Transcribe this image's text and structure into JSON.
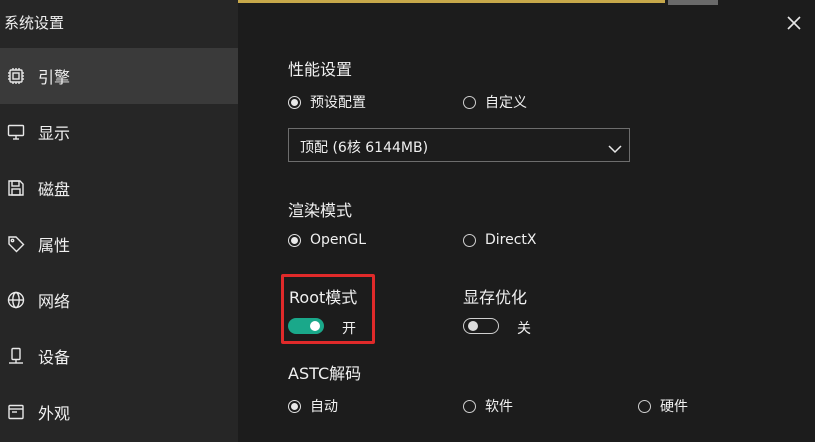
{
  "window": {
    "title": "系统设置"
  },
  "sidebar": {
    "items": [
      {
        "label": "引擎",
        "icon": "chip-icon",
        "active": true
      },
      {
        "label": "显示",
        "icon": "monitor-icon",
        "active": false
      },
      {
        "label": "磁盘",
        "icon": "disk-icon",
        "active": false
      },
      {
        "label": "属性",
        "icon": "tag-icon",
        "active": false
      },
      {
        "label": "网络",
        "icon": "globe-icon",
        "active": false
      },
      {
        "label": "设备",
        "icon": "phone-icon",
        "active": false
      },
      {
        "label": "外观",
        "icon": "window-icon",
        "active": false
      }
    ]
  },
  "performance": {
    "title": "性能设置",
    "options": [
      {
        "label": "预设配置",
        "checked": true
      },
      {
        "label": "自定义",
        "checked": false
      }
    ],
    "preset_value": "顶配 (6核 6144MB)"
  },
  "render": {
    "title": "渲染模式",
    "options": [
      {
        "label": "OpenGL",
        "checked": true
      },
      {
        "label": "DirectX",
        "checked": false
      }
    ]
  },
  "root": {
    "title": "Root模式",
    "state_label": "开",
    "on": true
  },
  "vram": {
    "title": "显存优化",
    "state_label": "关",
    "on": false
  },
  "astc": {
    "title": "ASTC解码",
    "options": [
      {
        "label": "自动",
        "checked": true
      },
      {
        "label": "软件",
        "checked": false
      },
      {
        "label": "硬件",
        "checked": false
      }
    ]
  },
  "colors": {
    "accent": "#1aa88a",
    "highlight": "#e02a2a",
    "sidebar_bg": "#262626",
    "content_bg": "#1c1c1c"
  }
}
